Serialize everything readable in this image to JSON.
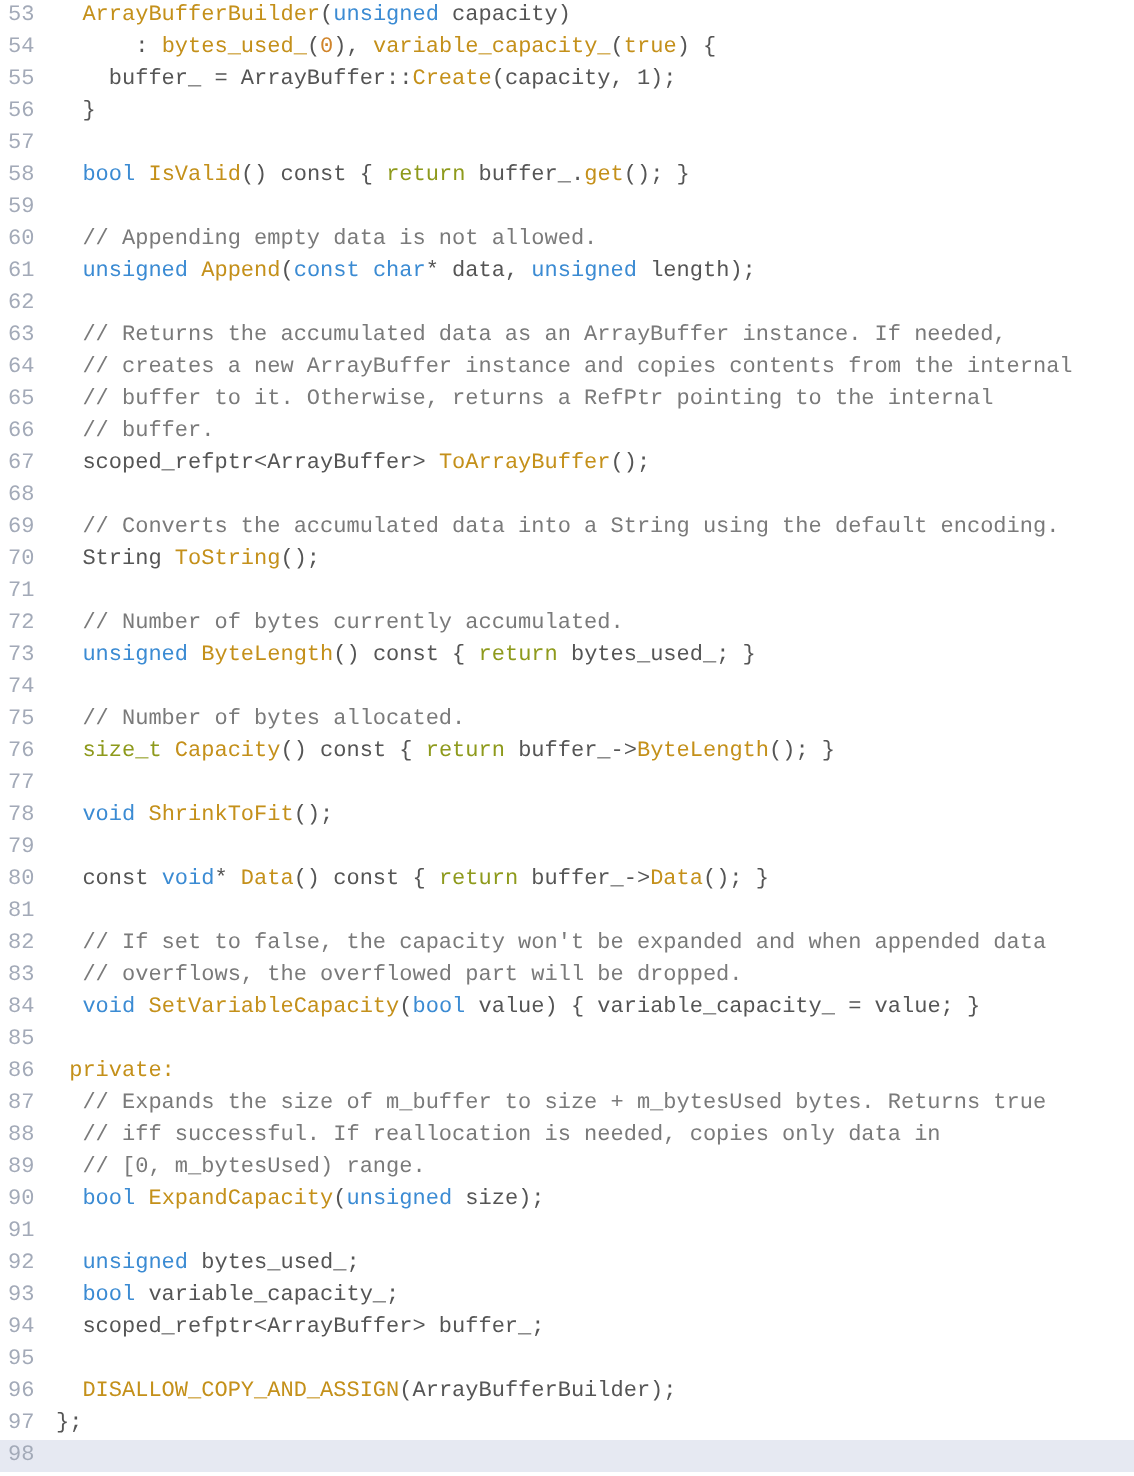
{
  "code_lines": [
    {
      "number": "53",
      "current": false,
      "tokens": [
        {
          "kind": "name",
          "text": "  ArrayBufferBuilder"
        },
        {
          "kind": "plain",
          "text": "("
        },
        {
          "kind": "keyword",
          "text": "unsigned"
        },
        {
          "kind": "plain",
          "text": " capacity)"
        }
      ]
    },
    {
      "number": "54",
      "current": false,
      "tokens": [
        {
          "kind": "plain",
          "text": "      : "
        },
        {
          "kind": "name",
          "text": "bytes_used_"
        },
        {
          "kind": "plain",
          "text": "("
        },
        {
          "kind": "number",
          "text": "0"
        },
        {
          "kind": "plain",
          "text": "), "
        },
        {
          "kind": "name",
          "text": "variable_capacity_"
        },
        {
          "kind": "plain",
          "text": "("
        },
        {
          "kind": "name",
          "text": "true"
        },
        {
          "kind": "plain",
          "text": ") {"
        }
      ]
    },
    {
      "number": "55",
      "current": false,
      "tokens": [
        {
          "kind": "plain",
          "text": "    buffer_ = ArrayBuffer::"
        },
        {
          "kind": "name",
          "text": "Create"
        },
        {
          "kind": "plain",
          "text": "(capacity, 1);"
        }
      ]
    },
    {
      "number": "56",
      "current": false,
      "tokens": [
        {
          "kind": "plain",
          "text": "  }"
        }
      ]
    },
    {
      "number": "57",
      "current": false
    },
    {
      "number": "58",
      "current": false,
      "tokens": [
        {
          "kind": "keyword",
          "text": "  bool "
        },
        {
          "kind": "name",
          "text": "IsValid"
        },
        {
          "kind": "plain",
          "text": "() const { "
        },
        {
          "kind": "control",
          "text": "return"
        },
        {
          "kind": "plain",
          "text": " buffer_."
        },
        {
          "kind": "name",
          "text": "get"
        },
        {
          "kind": "plain",
          "text": "(); }"
        }
      ]
    },
    {
      "number": "59",
      "current": false
    },
    {
      "number": "60",
      "current": false,
      "tokens": [
        {
          "kind": "comment",
          "text": "  // Appending empty data is not allowed."
        }
      ]
    },
    {
      "number": "61",
      "current": false,
      "tokens": [
        {
          "kind": "keyword",
          "text": "  unsigned "
        },
        {
          "kind": "name",
          "text": "Append"
        },
        {
          "kind": "plain",
          "text": "("
        },
        {
          "kind": "keyword",
          "text": "const char"
        },
        {
          "kind": "plain",
          "text": "* data, "
        },
        {
          "kind": "keyword",
          "text": "unsigned"
        },
        {
          "kind": "plain",
          "text": " length);"
        }
      ]
    },
    {
      "number": "62",
      "current": false
    },
    {
      "number": "63",
      "current": false,
      "tokens": [
        {
          "kind": "comment",
          "text": "  // Returns the accumulated data as an ArrayBuffer instance. If needed,"
        }
      ]
    },
    {
      "number": "64",
      "current": false,
      "tokens": [
        {
          "kind": "comment",
          "text": "  // creates a new ArrayBuffer instance and copies contents from the internal"
        }
      ]
    },
    {
      "number": "65",
      "current": false,
      "tokens": [
        {
          "kind": "comment",
          "text": "  // buffer to it. Otherwise, returns a RefPtr pointing to the internal"
        }
      ]
    },
    {
      "number": "66",
      "current": false,
      "tokens": [
        {
          "kind": "comment",
          "text": "  // buffer."
        }
      ]
    },
    {
      "number": "67",
      "current": false,
      "tokens": [
        {
          "kind": "plain",
          "text": "  scoped_refptr<ArrayBuffer> "
        },
        {
          "kind": "name",
          "text": "ToArrayBuffer"
        },
        {
          "kind": "plain",
          "text": "();"
        }
      ]
    },
    {
      "number": "68",
      "current": false
    },
    {
      "number": "69",
      "current": false,
      "tokens": [
        {
          "kind": "comment",
          "text": "  // Converts the accumulated data into a String using the default encoding."
        }
      ]
    },
    {
      "number": "70",
      "current": false,
      "tokens": [
        {
          "kind": "plain",
          "text": "  String "
        },
        {
          "kind": "name",
          "text": "ToString"
        },
        {
          "kind": "plain",
          "text": "();"
        }
      ]
    },
    {
      "number": "71",
      "current": false
    },
    {
      "number": "72",
      "current": false,
      "tokens": [
        {
          "kind": "comment",
          "text": "  // Number of bytes currently accumulated."
        }
      ]
    },
    {
      "number": "73",
      "current": false,
      "tokens": [
        {
          "kind": "keyword",
          "text": "  unsigned "
        },
        {
          "kind": "name",
          "text": "ByteLength"
        },
        {
          "kind": "plain",
          "text": "() const { "
        },
        {
          "kind": "control",
          "text": "return"
        },
        {
          "kind": "plain",
          "text": " bytes_used_; }"
        }
      ]
    },
    {
      "number": "74",
      "current": false
    },
    {
      "number": "75",
      "current": false,
      "tokens": [
        {
          "kind": "comment",
          "text": "  // Number of bytes allocated."
        }
      ]
    },
    {
      "number": "76",
      "current": false,
      "tokens": [
        {
          "kind": "control",
          "text": "  size_t "
        },
        {
          "kind": "name",
          "text": "Capacity"
        },
        {
          "kind": "plain",
          "text": "() const { "
        },
        {
          "kind": "control",
          "text": "return"
        },
        {
          "kind": "plain",
          "text": " buffer_->"
        },
        {
          "kind": "name",
          "text": "ByteLength"
        },
        {
          "kind": "plain",
          "text": "(); }"
        }
      ]
    },
    {
      "number": "77",
      "current": false
    },
    {
      "number": "78",
      "current": false,
      "tokens": [
        {
          "kind": "keyword",
          "text": "  void "
        },
        {
          "kind": "name",
          "text": "ShrinkToFit"
        },
        {
          "kind": "plain",
          "text": "();"
        }
      ]
    },
    {
      "number": "79",
      "current": false
    },
    {
      "number": "80",
      "current": false,
      "tokens": [
        {
          "kind": "plain",
          "text": "  const "
        },
        {
          "kind": "keyword",
          "text": "void"
        },
        {
          "kind": "plain",
          "text": "* "
        },
        {
          "kind": "name",
          "text": "Data"
        },
        {
          "kind": "plain",
          "text": "() const { "
        },
        {
          "kind": "control",
          "text": "return"
        },
        {
          "kind": "plain",
          "text": " buffer_->"
        },
        {
          "kind": "name",
          "text": "Data"
        },
        {
          "kind": "plain",
          "text": "(); }"
        }
      ]
    },
    {
      "number": "81",
      "current": false
    },
    {
      "number": "82",
      "current": false,
      "tokens": [
        {
          "kind": "comment",
          "text": "  // If set to false, the capacity won't be expanded and when appended data"
        }
      ]
    },
    {
      "number": "83",
      "current": false,
      "tokens": [
        {
          "kind": "comment",
          "text": "  // overflows, the overflowed part will be dropped."
        }
      ]
    },
    {
      "number": "84",
      "current": false,
      "tokens": [
        {
          "kind": "keyword",
          "text": "  void "
        },
        {
          "kind": "name",
          "text": "SetVariableCapacity"
        },
        {
          "kind": "plain",
          "text": "("
        },
        {
          "kind": "keyword",
          "text": "bool"
        },
        {
          "kind": "plain",
          "text": " value) { variable_capacity_ = value; }"
        }
      ]
    },
    {
      "number": "85",
      "current": false
    },
    {
      "number": "86",
      "current": false,
      "tokens": [
        {
          "kind": "name",
          "text": " private:"
        }
      ]
    },
    {
      "number": "87",
      "current": false,
      "tokens": [
        {
          "kind": "comment",
          "text": "  // Expands the size of m_buffer to size + m_bytesUsed bytes. Returns true"
        }
      ]
    },
    {
      "number": "88",
      "current": false,
      "tokens": [
        {
          "kind": "comment",
          "text": "  // iff successful. If reallocation is needed, copies only data in"
        }
      ]
    },
    {
      "number": "89",
      "current": false,
      "tokens": [
        {
          "kind": "comment",
          "text": "  // [0, m_bytesUsed) range."
        }
      ]
    },
    {
      "number": "90",
      "current": false,
      "tokens": [
        {
          "kind": "keyword",
          "text": "  bool "
        },
        {
          "kind": "name",
          "text": "ExpandCapacity"
        },
        {
          "kind": "plain",
          "text": "("
        },
        {
          "kind": "keyword",
          "text": "unsigned"
        },
        {
          "kind": "plain",
          "text": " size);"
        }
      ]
    },
    {
      "number": "91",
      "current": false
    },
    {
      "number": "92",
      "current": false,
      "tokens": [
        {
          "kind": "keyword",
          "text": "  unsigned"
        },
        {
          "kind": "plain",
          "text": " bytes_used_;"
        }
      ]
    },
    {
      "number": "93",
      "current": false,
      "tokens": [
        {
          "kind": "keyword",
          "text": "  bool"
        },
        {
          "kind": "plain",
          "text": " variable_capacity_;"
        }
      ]
    },
    {
      "number": "94",
      "current": false,
      "tokens": [
        {
          "kind": "plain",
          "text": "  scoped_refptr<ArrayBuffer> buffer_;"
        }
      ]
    },
    {
      "number": "95",
      "current": false
    },
    {
      "number": "96",
      "current": false,
      "tokens": [
        {
          "kind": "name",
          "text": "  DISALLOW_COPY_AND_ASSIGN"
        },
        {
          "kind": "plain",
          "text": "(ArrayBufferBuilder);"
        }
      ]
    },
    {
      "number": "97",
      "current": false,
      "tokens": [
        {
          "kind": "plain",
          "text": "};"
        }
      ]
    },
    {
      "number": "98",
      "current": true
    }
  ]
}
